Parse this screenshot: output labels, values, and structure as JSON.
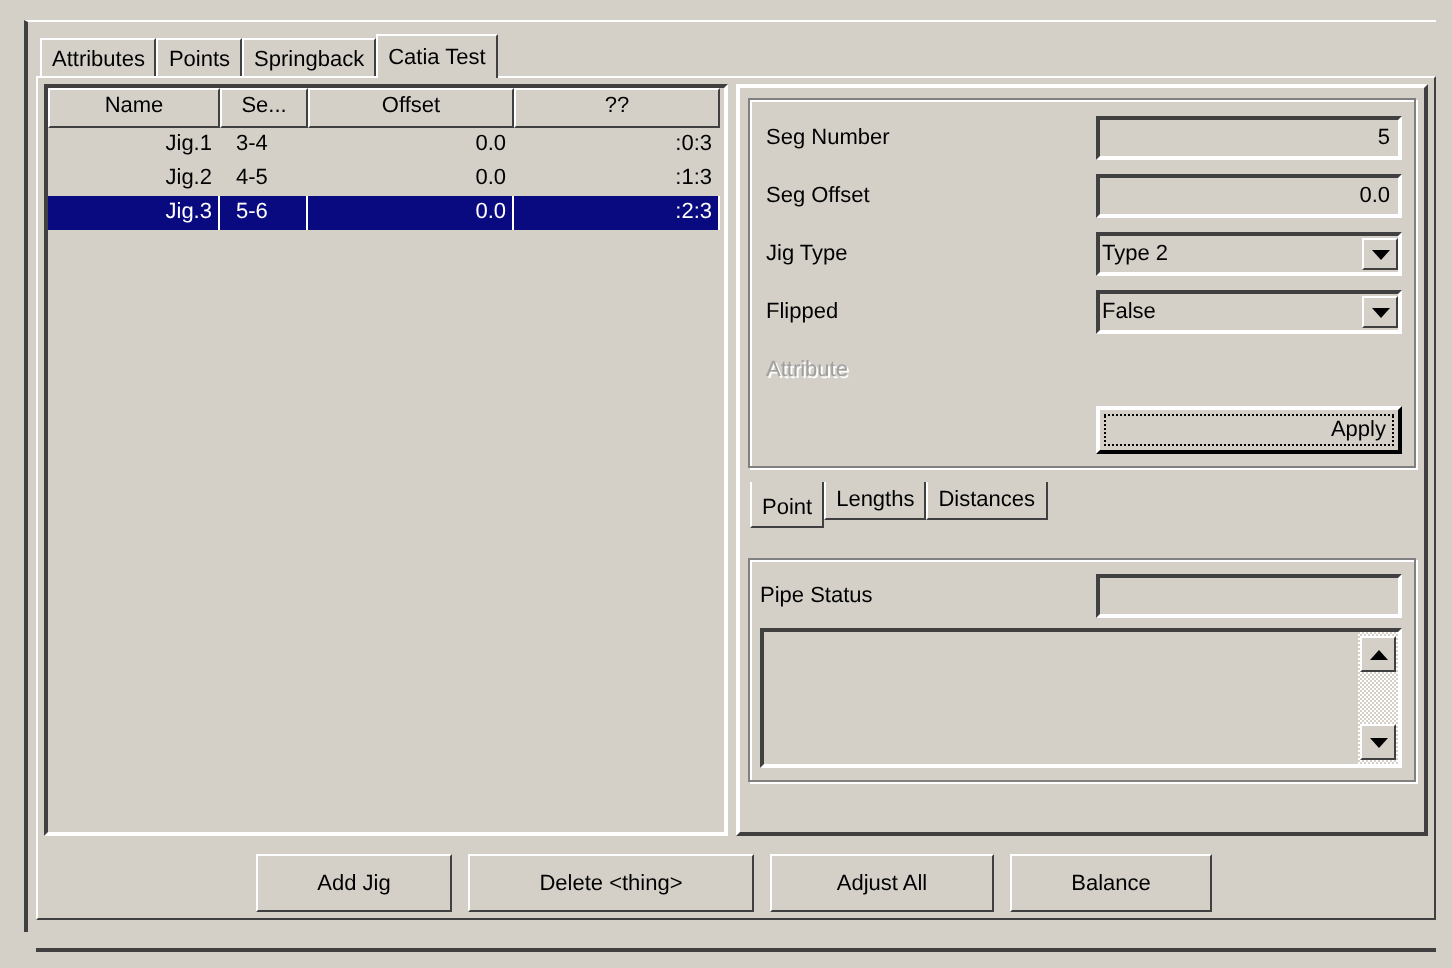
{
  "tabs": [
    {
      "label": "Attributes",
      "selected": false
    },
    {
      "label": "Points",
      "selected": false
    },
    {
      "label": "Springback",
      "selected": false
    },
    {
      "label": "Catia Test",
      "selected": true
    }
  ],
  "table": {
    "columns": [
      "Name",
      "Se...",
      "Offset",
      "??"
    ],
    "rows": [
      {
        "cells": [
          "Jig.1",
          "3-4",
          "0.0",
          ":0:3"
        ],
        "selected": false
      },
      {
        "cells": [
          "Jig.2",
          "4-5",
          "0.0",
          ":1:3"
        ],
        "selected": false
      },
      {
        "cells": [
          "Jig.3",
          "5-6",
          "0.0",
          ":2:3"
        ],
        "selected": true
      }
    ]
  },
  "form": [
    {
      "kind": "text",
      "label": "Seg Number",
      "value": "5",
      "disabled": false
    },
    {
      "kind": "text",
      "label": "Seg Offset",
      "value": "0.0",
      "disabled": false
    },
    {
      "kind": "dropdown",
      "label": "Jig Type",
      "value": "Type 2",
      "disabled": false
    },
    {
      "kind": "dropdown",
      "label": "Flipped",
      "value": "False",
      "disabled": false
    },
    {
      "kind": "label",
      "label": "Attribute",
      "disabled": true
    }
  ],
  "apply_button": "Apply",
  "sub_tabs": [
    {
      "label": "Point",
      "selected": true
    },
    {
      "label": "Lengths",
      "selected": false
    },
    {
      "label": "Distances",
      "selected": false
    }
  ],
  "pipe_status": {
    "label": "Pipe Status"
  },
  "buttons": [
    "Add Jig",
    "Delete <thing>",
    "Adjust All",
    "Balance"
  ]
}
